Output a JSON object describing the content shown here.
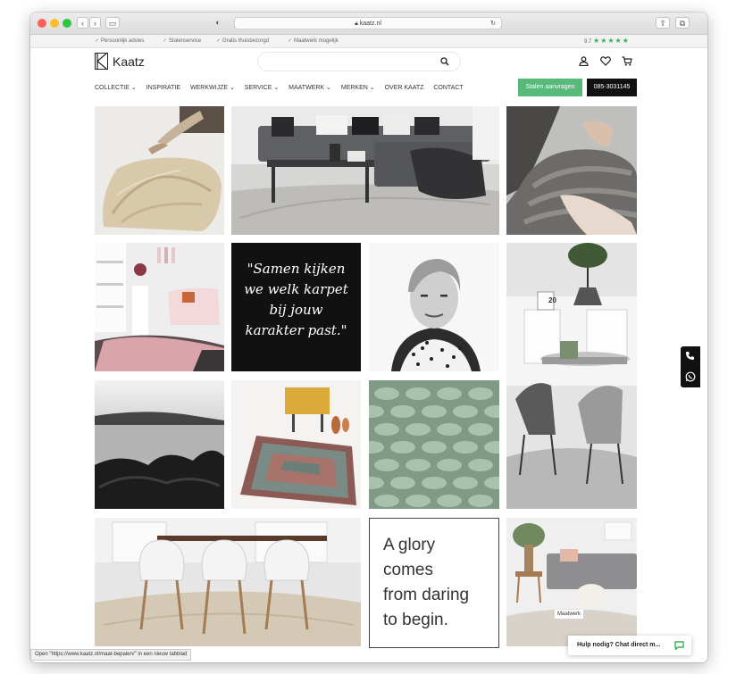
{
  "browser": {
    "url": "kaatz.nl",
    "status_text": "Open \"https://www.kaatz.nl/maat-bepalen/\" in een nieuw tabblad"
  },
  "usp_bar": {
    "items": [
      "Persoonlijk advies",
      "Stalenservice",
      "Gratis thuisbezorgd",
      "Maatwerk mogelijk"
    ],
    "rating_value": "9.7",
    "rating_stars": "★★★★★"
  },
  "header": {
    "logo_text": "Kaatz",
    "search_placeholder": ""
  },
  "nav": {
    "items": [
      "COLLECTIE ⌄",
      "INSPIRATIE",
      "WERKWIJZE ⌄",
      "SERVICE ⌄",
      "MAATWERK ⌄",
      "MERKEN ⌄",
      "OVER KAATZ",
      "CONTACT"
    ],
    "cta_samples": "Stalen aanvragen",
    "phone": "085-3031145"
  },
  "grid": {
    "quote_lines": [
      "\"Samen kijken",
      "we welk karpet",
      "bij jouw",
      "karakter past.\""
    ],
    "glory_lines": [
      "A glory",
      "comes",
      "from daring",
      "to begin."
    ],
    "lamp_sign": "20",
    "maatwerk_badge": "Maatwerk"
  },
  "chat": {
    "label": "Hulp nodig? Chat direct m..."
  },
  "colors": {
    "accent_green": "#57b97a",
    "dark": "#111111"
  }
}
